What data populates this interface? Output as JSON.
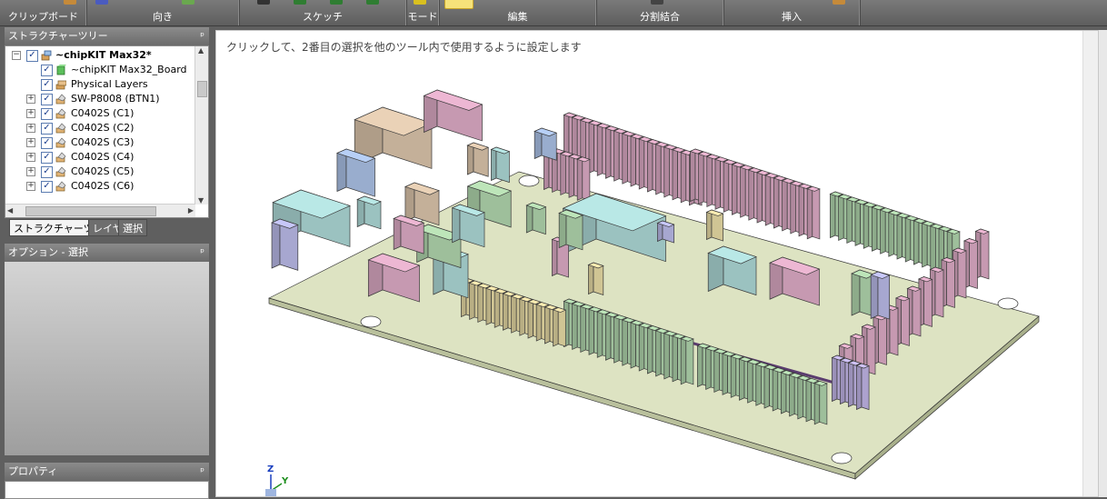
{
  "ribbon": {
    "groups": [
      {
        "label": "クリップボード"
      },
      {
        "label": "向き"
      },
      {
        "label": "スケッチ"
      },
      {
        "label": "モード"
      },
      {
        "label": "編集"
      },
      {
        "label": "分割結合"
      },
      {
        "label": "挿入"
      }
    ]
  },
  "structure_tree": {
    "title": "ストラクチャーツリー",
    "pin": "ᵖ",
    "root": {
      "label": "~chipKIT Max32*"
    },
    "items": [
      {
        "label": "~chipKIT Max32_Board",
        "icon": "green-body-icon",
        "expandable": false
      },
      {
        "label": "Physical Layers",
        "icon": "layers-icon",
        "expandable": false
      },
      {
        "label": "SW-P8008 (BTN1)",
        "icon": "component-icon",
        "expandable": true
      },
      {
        "label": "C0402S (C1)",
        "icon": "component-icon",
        "expandable": true
      },
      {
        "label": "C0402S (C2)",
        "icon": "component-icon",
        "expandable": true
      },
      {
        "label": "C0402S (C3)",
        "icon": "component-icon",
        "expandable": true
      },
      {
        "label": "C0402S (C4)",
        "icon": "component-icon",
        "expandable": true
      },
      {
        "label": "C0402S (C5)",
        "icon": "component-icon",
        "expandable": true
      },
      {
        "label": "C0402S (C6)",
        "icon": "component-icon",
        "expandable": true
      }
    ],
    "tabs": [
      {
        "label": "ストラクチャーツリー"
      },
      {
        "label": "レイヤ"
      },
      {
        "label": "選択"
      }
    ]
  },
  "options_panel": {
    "title": "オプション - 選択",
    "pin": "ᵖ"
  },
  "properties_panel": {
    "title": "プロパティ",
    "pin": "ᵖ"
  },
  "viewport": {
    "hint": "クリックして、2番目の選択を他のツール内で使用するように設定します",
    "triad": {
      "z": "Z",
      "y": "Y"
    }
  }
}
